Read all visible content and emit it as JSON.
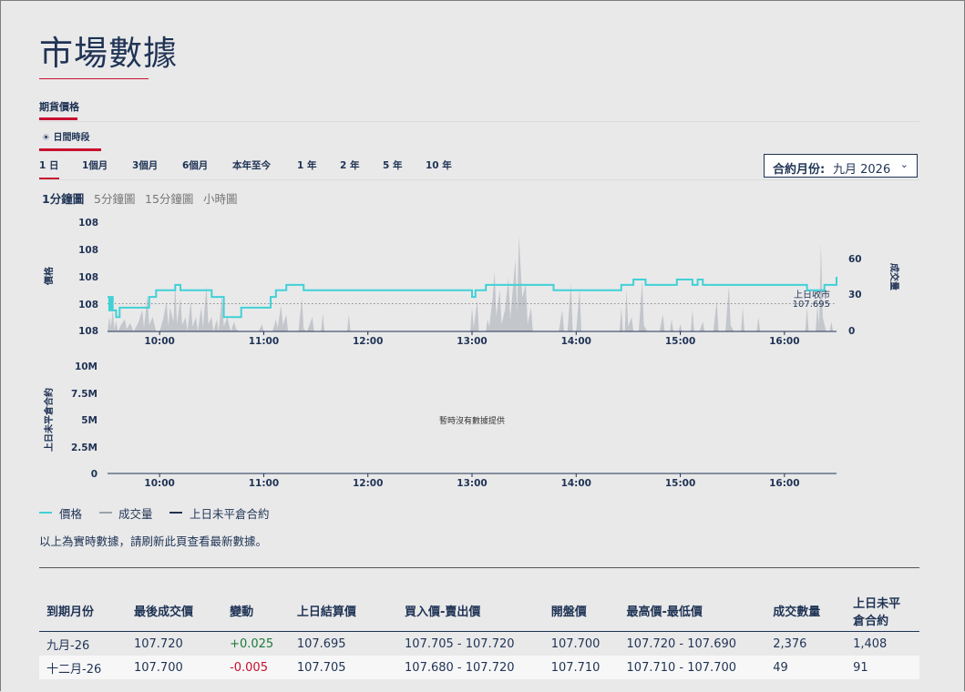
{
  "page": {
    "title": "市場數據"
  },
  "tabs": {
    "primary": "期貨價格",
    "session": "日間時段",
    "session_icon": "sun-icon"
  },
  "ranges": [
    "1 日",
    "1個月",
    "3個月",
    "6個月",
    "本年至今",
    "1 年",
    "2 年",
    "5 年",
    "10 年"
  ],
  "contract_select": {
    "label": "合約月份:",
    "value": "九月 2026"
  },
  "intervals": [
    "1分鐘圖",
    "5分鐘圖",
    "15分鐘圖",
    "小時圖"
  ],
  "chart_data": [
    {
      "type": "line",
      "xlabels": [
        "10:00",
        "11:00",
        "12:00",
        "13:00",
        "14:00",
        "15:00",
        "16:00"
      ],
      "ylabel": "價格",
      "y_ticks": [
        "108",
        "108",
        "108",
        "108",
        "108"
      ],
      "ylim": [
        107.685,
        107.725
      ],
      "y2label": "成交量",
      "y2_ticks": [
        "60",
        "30",
        "0"
      ],
      "y2lim": [
        0,
        90
      ],
      "reference": {
        "label": "上日收市",
        "value_label": "107.695",
        "value": 107.695
      },
      "x_range": [
        "09:30",
        "16:30"
      ],
      "series": [
        {
          "name": "價格",
          "color": "#40d1d6",
          "points": [
            [
              "09:30",
              107.6975
            ],
            [
              "09:31",
              107.6925
            ],
            [
              "09:32",
              107.6975
            ],
            [
              "09:33",
              107.6925
            ],
            [
              "09:35",
              107.69
            ],
            [
              "09:37",
              107.6935
            ],
            [
              "09:54",
              107.6975
            ],
            [
              "09:58",
              107.7
            ],
            [
              "10:09",
              107.702
            ],
            [
              "10:12",
              107.7
            ],
            [
              "10:30",
              107.6975
            ],
            [
              "10:37",
              107.69
            ],
            [
              "10:45",
              107.69
            ],
            [
              "10:47",
              107.6935
            ],
            [
              "11:04",
              107.6975
            ],
            [
              "11:07",
              107.7
            ],
            [
              "11:13",
              107.702
            ],
            [
              "11:23",
              107.7
            ],
            [
              "13:00",
              107.6975
            ],
            [
              "13:02",
              107.7
            ],
            [
              "13:08",
              107.702
            ],
            [
              "13:47",
              107.7
            ],
            [
              "14:26",
              107.702
            ],
            [
              "14:33",
              107.704
            ],
            [
              "14:40",
              107.702
            ],
            [
              "14:58",
              107.704
            ],
            [
              "15:07",
              107.702
            ],
            [
              "15:10",
              107.704
            ],
            [
              "15:13",
              107.702
            ],
            [
              "16:13",
              107.7
            ],
            [
              "16:23",
              107.702
            ],
            [
              "16:29",
              107.702
            ],
            [
              "16:30",
              107.705
            ]
          ]
        },
        {
          "name": "成交量",
          "color": "#b9bdc3",
          "points": [
            [
              "09:30",
              0
            ],
            [
              "09:31",
              12
            ],
            [
              "09:32",
              4
            ],
            [
              "09:33",
              18
            ],
            [
              "09:34",
              2
            ],
            [
              "09:35",
              9
            ],
            [
              "09:36",
              0
            ],
            [
              "09:38",
              6
            ],
            [
              "09:40",
              10
            ],
            [
              "09:41",
              2
            ],
            [
              "09:43",
              7
            ],
            [
              "09:45",
              0
            ],
            [
              "09:48",
              8
            ],
            [
              "09:50",
              18
            ],
            [
              "09:51",
              3
            ],
            [
              "09:53",
              30
            ],
            [
              "09:54",
              5
            ],
            [
              "09:56",
              12
            ],
            [
              "09:58",
              0
            ],
            [
              "10:00",
              0
            ],
            [
              "10:02",
              10
            ],
            [
              "10:04",
              25
            ],
            [
              "10:05",
              4
            ],
            [
              "10:06",
              20
            ],
            [
              "10:08",
              8
            ],
            [
              "10:09",
              40
            ],
            [
              "10:10",
              6
            ],
            [
              "10:12",
              28
            ],
            [
              "10:13",
              5
            ],
            [
              "10:15",
              12
            ],
            [
              "10:16",
              0
            ],
            [
              "10:18",
              25
            ],
            [
              "10:19",
              4
            ],
            [
              "10:21",
              12
            ],
            [
              "10:22",
              0
            ],
            [
              "10:24",
              20
            ],
            [
              "10:25",
              3
            ],
            [
              "10:27",
              38
            ],
            [
              "10:28",
              6
            ],
            [
              "10:30",
              12
            ],
            [
              "10:31",
              0
            ],
            [
              "10:33",
              10
            ],
            [
              "10:34",
              0
            ],
            [
              "10:36",
              30
            ],
            [
              "10:37",
              4
            ],
            [
              "10:39",
              12
            ],
            [
              "10:41",
              0
            ],
            [
              "10:43",
              8
            ],
            [
              "10:44",
              2
            ],
            [
              "10:46",
              0
            ],
            [
              "10:57",
              0
            ],
            [
              "10:59",
              6
            ],
            [
              "11:00",
              0
            ],
            [
              "11:05",
              0
            ],
            [
              "11:07",
              10
            ],
            [
              "11:08",
              3
            ],
            [
              "11:10",
              22
            ],
            [
              "11:11",
              5
            ],
            [
              "11:13",
              14
            ],
            [
              "11:14",
              0
            ],
            [
              "11:20",
              0
            ],
            [
              "11:22",
              28
            ],
            [
              "11:23",
              2
            ],
            [
              "11:25",
              0
            ],
            [
              "11:28",
              12
            ],
            [
              "11:29",
              0
            ],
            [
              "11:33",
              0
            ],
            [
              "11:34",
              15
            ],
            [
              "11:35",
              0
            ],
            [
              "11:48",
              0
            ],
            [
              "11:49",
              14
            ],
            [
              "11:50",
              0
            ],
            [
              "12:59",
              0
            ],
            [
              "13:00",
              20
            ],
            [
              "13:01",
              3
            ],
            [
              "13:03",
              26
            ],
            [
              "13:04",
              0
            ],
            [
              "13:08",
              0
            ],
            [
              "13:09",
              10
            ],
            [
              "13:10",
              4
            ],
            [
              "13:12",
              30
            ],
            [
              "13:13",
              50
            ],
            [
              "13:14",
              12
            ],
            [
              "13:16",
              35
            ],
            [
              "13:17",
              6
            ],
            [
              "13:19",
              18
            ],
            [
              "13:21",
              45
            ],
            [
              "13:22",
              10
            ],
            [
              "13:25",
              60
            ],
            [
              "13:26",
              15
            ],
            [
              "13:27",
              79
            ],
            [
              "13:29",
              28
            ],
            [
              "13:31",
              40
            ],
            [
              "13:32",
              6
            ],
            [
              "13:34",
              20
            ],
            [
              "13:35",
              0
            ],
            [
              "13:50",
              0
            ],
            [
              "13:52",
              18
            ],
            [
              "13:53",
              0
            ],
            [
              "13:55",
              0
            ],
            [
              "13:57",
              40
            ],
            [
              "13:58",
              0
            ],
            [
              "14:00",
              0
            ],
            [
              "14:02",
              35
            ],
            [
              "14:03",
              0
            ],
            [
              "14:25",
              0
            ],
            [
              "14:26",
              20
            ],
            [
              "14:27",
              0
            ],
            [
              "14:28",
              0
            ],
            [
              "14:29",
              35
            ],
            [
              "14:30",
              4
            ],
            [
              "14:32",
              12
            ],
            [
              "14:33",
              0
            ],
            [
              "14:36",
              0
            ],
            [
              "14:38",
              42
            ],
            [
              "14:39",
              5
            ],
            [
              "14:41",
              0
            ],
            [
              "14:48",
              0
            ],
            [
              "14:50",
              14
            ],
            [
              "14:51",
              0
            ],
            [
              "14:54",
              0
            ],
            [
              "14:55",
              10
            ],
            [
              "14:56",
              0
            ],
            [
              "14:59",
              0
            ],
            [
              "15:00",
              6
            ],
            [
              "15:01",
              0
            ],
            [
              "15:06",
              0
            ],
            [
              "15:07",
              18
            ],
            [
              "15:08",
              0
            ],
            [
              "15:11",
              0
            ],
            [
              "15:13",
              8
            ],
            [
              "15:14",
              0
            ],
            [
              "15:19",
              0
            ],
            [
              "15:21",
              26
            ],
            [
              "15:22",
              0
            ],
            [
              "15:26",
              0
            ],
            [
              "15:28",
              38
            ],
            [
              "15:29",
              5
            ],
            [
              "15:31",
              0
            ],
            [
              "15:35",
              0
            ],
            [
              "15:36",
              20
            ],
            [
              "15:37",
              0
            ],
            [
              "15:44",
              0
            ],
            [
              "15:45",
              12
            ],
            [
              "15:46",
              0
            ],
            [
              "16:12",
              0
            ],
            [
              "16:13",
              20
            ],
            [
              "16:14",
              0
            ],
            [
              "16:18",
              0
            ],
            [
              "16:19",
              22
            ],
            [
              "16:20",
              5
            ],
            [
              "16:21",
              74
            ],
            [
              "16:22",
              12
            ],
            [
              "16:24",
              0
            ],
            [
              "16:26",
              0
            ],
            [
              "16:27",
              8
            ],
            [
              "16:28",
              0
            ],
            [
              "16:30",
              0
            ]
          ]
        }
      ]
    },
    {
      "type": "line",
      "ylabel": "上日未平倉合約",
      "y_ticks": [
        "10M",
        "7.5M",
        "5M",
        "2.5M",
        "0"
      ],
      "ylim": [
        0,
        10000000
      ],
      "xlabels": [
        "10:00",
        "11:00",
        "12:00",
        "13:00",
        "14:00",
        "15:00",
        "16:00"
      ],
      "no_data_text": "暫時沒有數據提供",
      "series": []
    }
  ],
  "legend": [
    {
      "label": "價格",
      "color": "#40d1d6"
    },
    {
      "label": "成交量",
      "color": "#9aa3ad"
    },
    {
      "label": "上日未平倉合約",
      "color": "#1f3354"
    }
  ],
  "note": "以上為實時數據，請刷新此頁查看最新數據。",
  "table": {
    "headers": [
      "到期月份",
      "最後成交價",
      "變動",
      "上日結算價",
      "買入價-賣出價",
      "開盤價",
      "最高價-最低價",
      "成交數量",
      "上日未平倉合約"
    ],
    "rows": [
      [
        "九月-26",
        "107.720",
        "+0.025",
        "107.695",
        "107.705 - 107.720",
        "107.700",
        "107.720 - 107.690",
        "2,376",
        "1,408"
      ],
      [
        "十二月-26",
        "107.700",
        "-0.005",
        "107.705",
        "107.680 - 107.720",
        "107.710",
        "107.710 - 107.700",
        "49",
        "91"
      ]
    ]
  }
}
